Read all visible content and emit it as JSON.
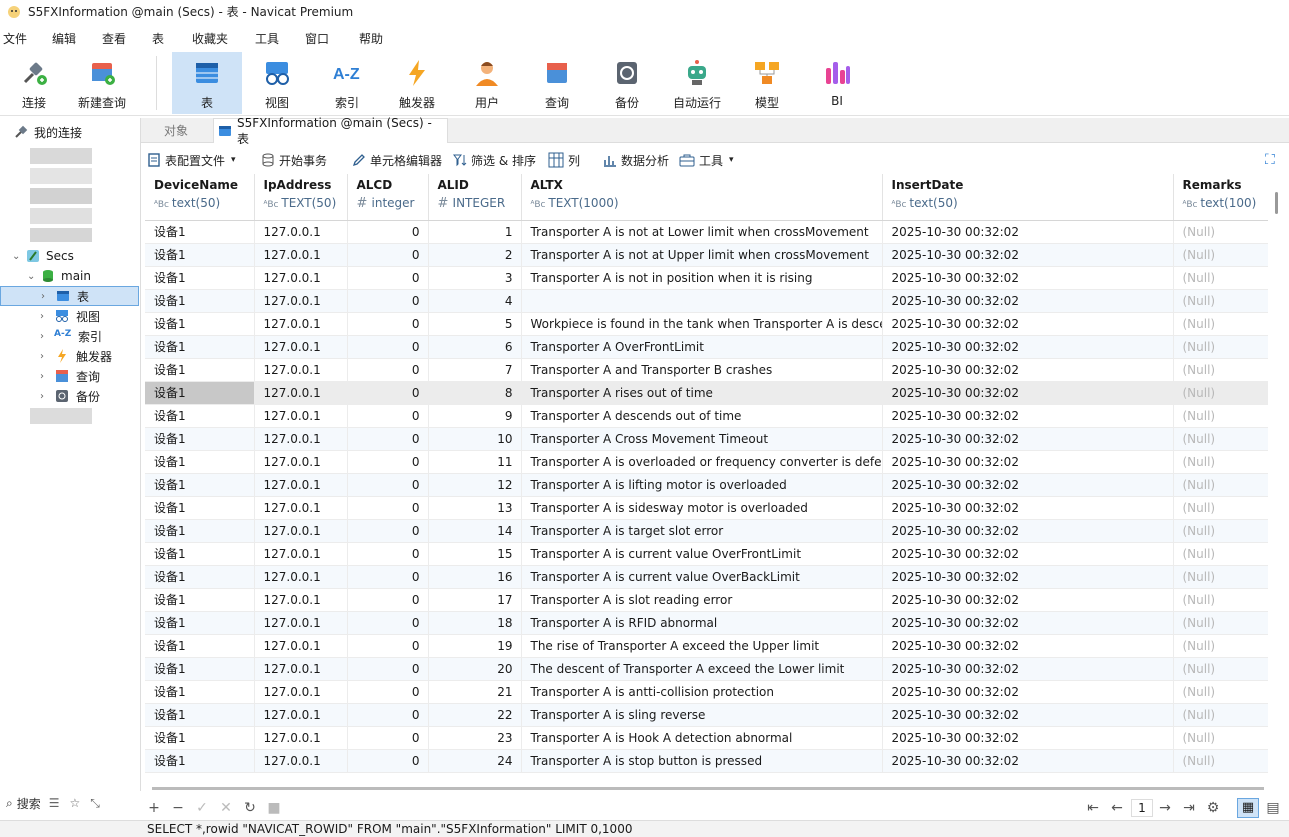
{
  "window": {
    "title": "S5FXInformation @main (Secs) - 表 - Navicat Premium"
  },
  "menu": [
    "文件",
    "编辑",
    "查看",
    "表",
    "收藏夹",
    "工具",
    "窗口",
    "帮助"
  ],
  "ribbon": [
    {
      "label": "连接",
      "icon": "connect-icon"
    },
    {
      "label": "新建查询",
      "icon": "new-query-icon"
    },
    {
      "label": "表",
      "icon": "table-icon"
    },
    {
      "label": "视图",
      "icon": "view-icon"
    },
    {
      "label": "索引",
      "icon": "index-icon"
    },
    {
      "label": "触发器",
      "icon": "trigger-icon"
    },
    {
      "label": "用户",
      "icon": "user-icon"
    },
    {
      "label": "查询",
      "icon": "query-icon"
    },
    {
      "label": "备份",
      "icon": "backup-icon"
    },
    {
      "label": "自动运行",
      "icon": "robot-icon"
    },
    {
      "label": "模型",
      "icon": "model-icon"
    },
    {
      "label": "BI",
      "icon": "bi-icon"
    }
  ],
  "sidebar": {
    "root": "我的连接",
    "db": "Secs",
    "schema": "main",
    "items": [
      "表",
      "视图",
      "索引",
      "触发器",
      "查询",
      "备份"
    ],
    "search": "搜索"
  },
  "tabs": {
    "objects": "对象",
    "active": "S5FXInformation @main (Secs) - 表"
  },
  "toolbar": {
    "profile": "表配置文件",
    "begin_tx": "开始事务",
    "cell_editor": "单元格编辑器",
    "filter_sort": "筛选 & 排序",
    "columns": "列",
    "analyze": "数据分析",
    "tools": "工具"
  },
  "columns": [
    {
      "name": "DeviceName",
      "type": "text(50)"
    },
    {
      "name": "IpAddress",
      "type": "TEXT(50)"
    },
    {
      "name": "ALCD",
      "type": "integer"
    },
    {
      "name": "ALID",
      "type": "INTEGER"
    },
    {
      "name": "ALTX",
      "type": "TEXT(1000)"
    },
    {
      "name": "InsertDate",
      "type": "text(50)"
    },
    {
      "name": "Remarks",
      "type": "text(100)"
    }
  ],
  "rows": [
    [
      "设备1",
      "127.0.0.1",
      "0",
      "1",
      "Transporter A is not at Lower limit when crossMovement",
      "2025-10-30 00:32:02",
      "(Null)"
    ],
    [
      "设备1",
      "127.0.0.1",
      "0",
      "2",
      "Transporter A is not at Upper limit when crossMovement",
      "2025-10-30 00:32:02",
      "(Null)"
    ],
    [
      "设备1",
      "127.0.0.1",
      "0",
      "3",
      "Transporter A is not in position when it is rising",
      "2025-10-30 00:32:02",
      "(Null)"
    ],
    [
      "设备1",
      "127.0.0.1",
      "0",
      "4",
      "",
      "2025-10-30 00:32:02",
      "(Null)"
    ],
    [
      "设备1",
      "127.0.0.1",
      "0",
      "5",
      "Workpiece is found in the tank when Transporter A is desce",
      "2025-10-30 00:32:02",
      "(Null)"
    ],
    [
      "设备1",
      "127.0.0.1",
      "0",
      "6",
      "Transporter A OverFrontLimit",
      "2025-10-30 00:32:02",
      "(Null)"
    ],
    [
      "设备1",
      "127.0.0.1",
      "0",
      "7",
      "Transporter A and Transporter B crashes",
      "2025-10-30 00:32:02",
      "(Null)"
    ],
    [
      "设备1",
      "127.0.0.1",
      "0",
      "8",
      "Transporter A rises out of time",
      "2025-10-30 00:32:02",
      "(Null)"
    ],
    [
      "设备1",
      "127.0.0.1",
      "0",
      "9",
      "Transporter A descends out of time",
      "2025-10-30 00:32:02",
      "(Null)"
    ],
    [
      "设备1",
      "127.0.0.1",
      "0",
      "10",
      "Transporter A Cross Movement Timeout",
      "2025-10-30 00:32:02",
      "(Null)"
    ],
    [
      "设备1",
      "127.0.0.1",
      "0",
      "11",
      "Transporter A is overloaded or frequency converter is defec",
      "2025-10-30 00:32:02",
      "(Null)"
    ],
    [
      "设备1",
      "127.0.0.1",
      "0",
      "12",
      "Transporter A is lifting motor is overloaded",
      "2025-10-30 00:32:02",
      "(Null)"
    ],
    [
      "设备1",
      "127.0.0.1",
      "0",
      "13",
      "Transporter A is sidesway motor is overloaded",
      "2025-10-30 00:32:02",
      "(Null)"
    ],
    [
      "设备1",
      "127.0.0.1",
      "0",
      "14",
      "Transporter A is target slot error",
      "2025-10-30 00:32:02",
      "(Null)"
    ],
    [
      "设备1",
      "127.0.0.1",
      "0",
      "15",
      "Transporter A is current value OverFrontLimit",
      "2025-10-30 00:32:02",
      "(Null)"
    ],
    [
      "设备1",
      "127.0.0.1",
      "0",
      "16",
      "Transporter A is current value OverBackLimit",
      "2025-10-30 00:32:02",
      "(Null)"
    ],
    [
      "设备1",
      "127.0.0.1",
      "0",
      "17",
      "Transporter A is slot reading error",
      "2025-10-30 00:32:02",
      "(Null)"
    ],
    [
      "设备1",
      "127.0.0.1",
      "0",
      "18",
      "Transporter A is RFID abnormal",
      "2025-10-30 00:32:02",
      "(Null)"
    ],
    [
      "设备1",
      "127.0.0.1",
      "0",
      "19",
      "The rise of Transporter A exceed the Upper limit",
      "2025-10-30 00:32:02",
      "(Null)"
    ],
    [
      "设备1",
      "127.0.0.1",
      "0",
      "20",
      "The descent of Transporter A exceed the Lower limit",
      "2025-10-30 00:32:02",
      "(Null)"
    ],
    [
      "设备1",
      "127.0.0.1",
      "0",
      "21",
      "Transporter A is antti-collision protection",
      "2025-10-30 00:32:02",
      "(Null)"
    ],
    [
      "设备1",
      "127.0.0.1",
      "0",
      "22",
      "Transporter A is sling reverse",
      "2025-10-30 00:32:02",
      "(Null)"
    ],
    [
      "设备1",
      "127.0.0.1",
      "0",
      "23",
      "Transporter A is Hook A detection abnormal",
      "2025-10-30 00:32:02",
      "(Null)"
    ],
    [
      "设备1",
      "127.0.0.1",
      "0",
      "24",
      "Transporter A is stop button is pressed",
      "2025-10-30 00:32:02",
      "(Null)"
    ]
  ],
  "pager": {
    "page": "1"
  },
  "status": {
    "sql": "SELECT *,rowid \"NAVICAT_ROWID\" FROM \"main\".\"S5FXInformation\" LIMIT 0,1000"
  },
  "colors": {
    "accent": "#cfe3f7",
    "null_text": "#b8b8b8",
    "alt_row": "#f5f9fd"
  }
}
